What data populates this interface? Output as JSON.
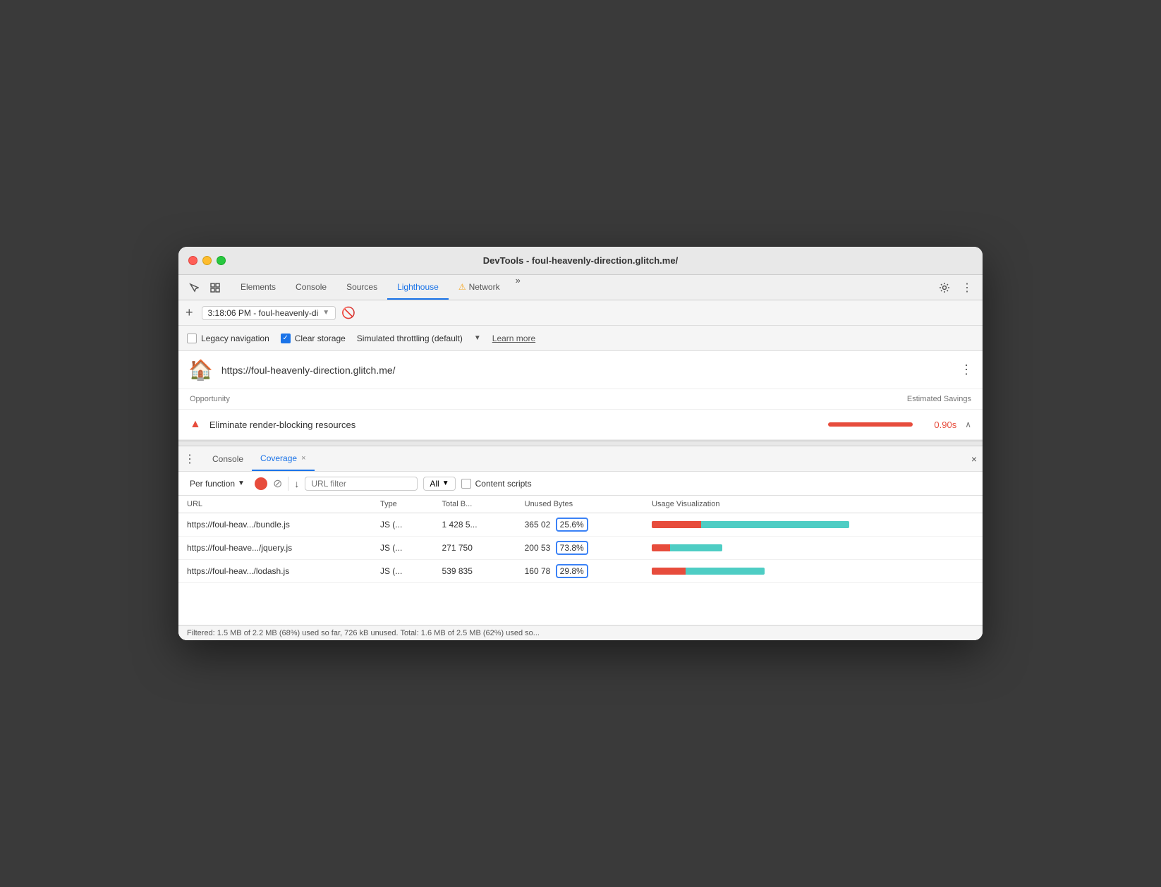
{
  "window": {
    "title": "DevTools - foul-heavenly-direction.glitch.me/"
  },
  "devtools_tabs": {
    "items": [
      {
        "label": "Elements",
        "active": false
      },
      {
        "label": "Console",
        "active": false
      },
      {
        "label": "Sources",
        "active": false
      },
      {
        "label": "Lighthouse",
        "active": true
      },
      {
        "label": "Network",
        "active": false,
        "warning": true
      }
    ],
    "more_label": "»"
  },
  "toolbar": {
    "add_label": "+",
    "url_text": "3:18:06 PM - foul-heavenly-di",
    "dropdown_arrow": "▼"
  },
  "options": {
    "legacy_nav_label": "Legacy navigation",
    "clear_storage_label": "Clear storage",
    "throttling_label": "Simulated throttling (default)",
    "dropdown_arrow": "▼",
    "learn_more_label": "Learn more"
  },
  "lighthouse": {
    "url": "https://foul-heavenly-direction.glitch.me/",
    "more_icon": "⋮"
  },
  "opportunity": {
    "header_label": "Opportunity",
    "savings_label": "Estimated Savings",
    "row": {
      "label": "Eliminate render-blocking resources",
      "savings": "0.90s"
    }
  },
  "coverage": {
    "console_tab_label": "Console",
    "coverage_tab_label": "Coverage",
    "close_label": "×",
    "per_function_label": "Per function",
    "url_filter_placeholder": "URL filter",
    "all_label": "All",
    "content_scripts_label": "Content scripts",
    "table": {
      "headers": [
        "URL",
        "Type",
        "Total B...",
        "Unused Bytes",
        "Usage Visualization"
      ],
      "rows": [
        {
          "url": "https://foul-heav.../bundle.js",
          "type": "JS (...",
          "total": "1 428 5...",
          "unused": "365 02",
          "pct": "25.6%",
          "used_pct": 25,
          "unused_pct": 75
        },
        {
          "url": "https://foul-heave.../jquery.js",
          "type": "JS (...",
          "total": "271 750",
          "unused": "200 53",
          "pct": "73.8%",
          "used_pct": 26,
          "unused_pct": 74
        },
        {
          "url": "https://foul-heav.../lodash.js",
          "type": "JS (...",
          "total": "539 835",
          "unused": "160 78",
          "pct": "29.8%",
          "used_pct": 30,
          "unused_pct": 70
        }
      ]
    },
    "status_bar": "Filtered: 1.5 MB of 2.2 MB (68%) used so far, 726 kB unused. Total: 1.6 MB of 2.5 MB (62%) used so..."
  }
}
